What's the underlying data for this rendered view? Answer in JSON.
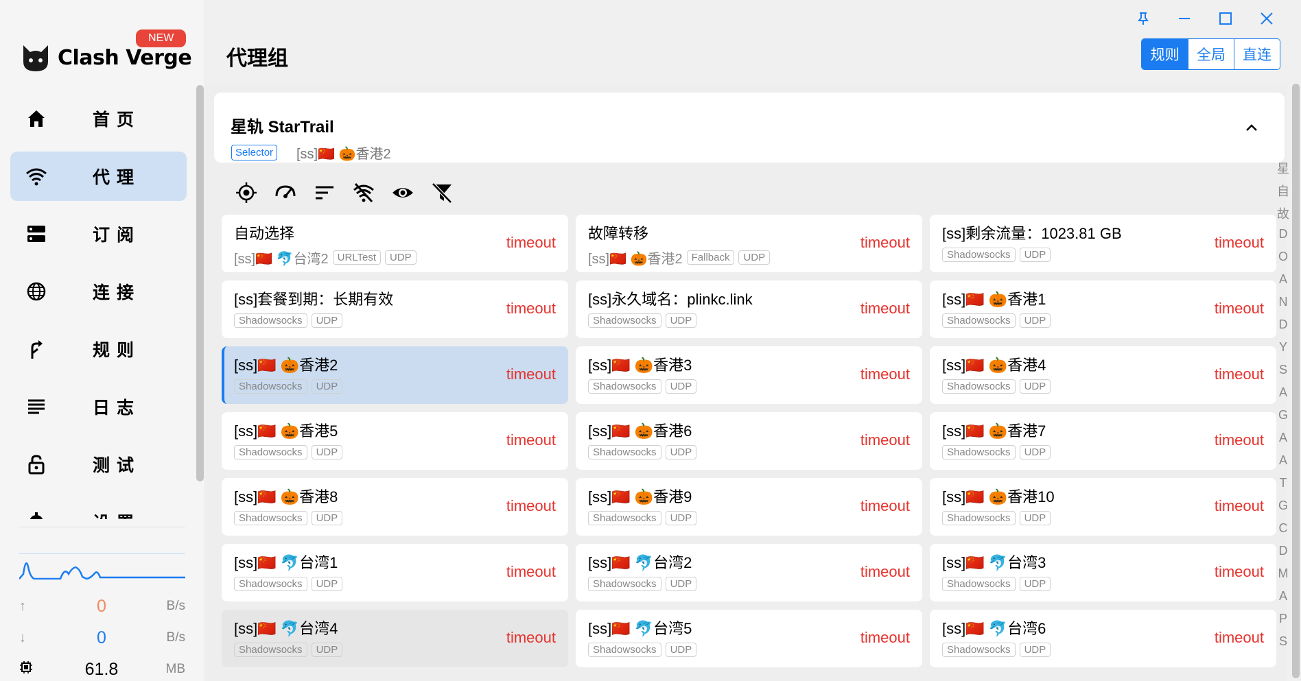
{
  "app": {
    "brand": "Clash Verge",
    "new_badge": "NEW"
  },
  "nav": [
    {
      "label": "首页",
      "icon": "home-icon",
      "active": false
    },
    {
      "label": "代理",
      "icon": "wifi-icon",
      "active": true
    },
    {
      "label": "订阅",
      "icon": "storage-icon",
      "active": false
    },
    {
      "label": "连接",
      "icon": "globe-icon",
      "active": false
    },
    {
      "label": "规则",
      "icon": "fork-icon",
      "active": false
    },
    {
      "label": "日志",
      "icon": "log-icon",
      "active": false
    },
    {
      "label": "测试",
      "icon": "lock-icon",
      "active": false
    },
    {
      "label": "设置",
      "icon": "settings-icon",
      "active": false
    }
  ],
  "traffic": {
    "up_value": "0",
    "up_unit": "B/s",
    "down_value": "0",
    "down_unit": "B/s",
    "mem_value": "61.8",
    "mem_unit": "MB"
  },
  "header": {
    "title": "代理组"
  },
  "modes": [
    {
      "label": "规则",
      "active": true
    },
    {
      "label": "全局",
      "active": false
    },
    {
      "label": "直连",
      "active": false
    }
  ],
  "group": {
    "name": "星轨 StarTrail",
    "type": "Selector",
    "now": "[ss]🇨🇳 🎃香港2"
  },
  "toolbar_icons": [
    "locate-icon",
    "speed-test-icon",
    "sort-icon",
    "filter-off-icon",
    "visibility-icon",
    "filter-clear-icon"
  ],
  "alpha_index": [
    "星",
    "自",
    "故",
    "D",
    "O",
    "A",
    "N",
    "D",
    "Y",
    "S",
    "A",
    "G",
    "A",
    "A",
    "T",
    "G",
    "C",
    "D",
    "M",
    "A",
    "P",
    "S"
  ],
  "proxies": [
    {
      "name": "自动选择",
      "sub": "[ss]🇨🇳 🐬台湾2",
      "tags": [
        "URLTest",
        "UDP"
      ],
      "delay": "timeout"
    },
    {
      "name": "故障转移",
      "sub": "[ss]🇨🇳 🎃香港2",
      "tags": [
        "Fallback",
        "UDP"
      ],
      "delay": "timeout"
    },
    {
      "name": "[ss]剩余流量：1023.81 GB",
      "sub": "",
      "tags": [
        "Shadowsocks",
        "UDP"
      ],
      "delay": "timeout"
    },
    {
      "name": "[ss]套餐到期：长期有效",
      "sub": "",
      "tags": [
        "Shadowsocks",
        "UDP"
      ],
      "delay": "timeout"
    },
    {
      "name": "[ss]永久域名：plinkc.link",
      "sub": "",
      "tags": [
        "Shadowsocks",
        "UDP"
      ],
      "delay": "timeout"
    },
    {
      "name": "[ss]🇨🇳 🎃香港1",
      "sub": "",
      "tags": [
        "Shadowsocks",
        "UDP"
      ],
      "delay": "timeout"
    },
    {
      "name": "[ss]🇨🇳 🎃香港2",
      "sub": "",
      "tags": [
        "Shadowsocks",
        "UDP"
      ],
      "delay": "timeout",
      "selected": true
    },
    {
      "name": "[ss]🇨🇳 🎃香港3",
      "sub": "",
      "tags": [
        "Shadowsocks",
        "UDP"
      ],
      "delay": "timeout"
    },
    {
      "name": "[ss]🇨🇳 🎃香港4",
      "sub": "",
      "tags": [
        "Shadowsocks",
        "UDP"
      ],
      "delay": "timeout"
    },
    {
      "name": "[ss]🇨🇳 🎃香港5",
      "sub": "",
      "tags": [
        "Shadowsocks",
        "UDP"
      ],
      "delay": "timeout"
    },
    {
      "name": "[ss]🇨🇳 🎃香港6",
      "sub": "",
      "tags": [
        "Shadowsocks",
        "UDP"
      ],
      "delay": "timeout"
    },
    {
      "name": "[ss]🇨🇳 🎃香港7",
      "sub": "",
      "tags": [
        "Shadowsocks",
        "UDP"
      ],
      "delay": "timeout"
    },
    {
      "name": "[ss]🇨🇳 🎃香港8",
      "sub": "",
      "tags": [
        "Shadowsocks",
        "UDP"
      ],
      "delay": "timeout"
    },
    {
      "name": "[ss]🇨🇳 🎃香港9",
      "sub": "",
      "tags": [
        "Shadowsocks",
        "UDP"
      ],
      "delay": "timeout"
    },
    {
      "name": "[ss]🇨🇳 🎃香港10",
      "sub": "",
      "tags": [
        "Shadowsocks",
        "UDP"
      ],
      "delay": "timeout"
    },
    {
      "name": "[ss]🇨🇳 🐬台湾1",
      "sub": "",
      "tags": [
        "Shadowsocks",
        "UDP"
      ],
      "delay": "timeout"
    },
    {
      "name": "[ss]🇨🇳 🐬台湾2",
      "sub": "",
      "tags": [
        "Shadowsocks",
        "UDP"
      ],
      "delay": "timeout"
    },
    {
      "name": "[ss]🇨🇳 🐬台湾3",
      "sub": "",
      "tags": [
        "Shadowsocks",
        "UDP"
      ],
      "delay": "timeout"
    },
    {
      "name": "[ss]🇨🇳 🐬台湾4",
      "sub": "",
      "tags": [
        "Shadowsocks",
        "UDP"
      ],
      "delay": "timeout",
      "hover": true
    },
    {
      "name": "[ss]🇨🇳 🐬台湾5",
      "sub": "",
      "tags": [
        "Shadowsocks",
        "UDP"
      ],
      "delay": "timeout"
    },
    {
      "name": "[ss]🇨🇳 🐬台湾6",
      "sub": "",
      "tags": [
        "Shadowsocks",
        "UDP"
      ],
      "delay": "timeout"
    }
  ],
  "colors": {
    "accent": "#1a7cf0",
    "timeout": "#e5322d",
    "selected_bg": "#cbdcf0",
    "badge": "#e8443a"
  }
}
